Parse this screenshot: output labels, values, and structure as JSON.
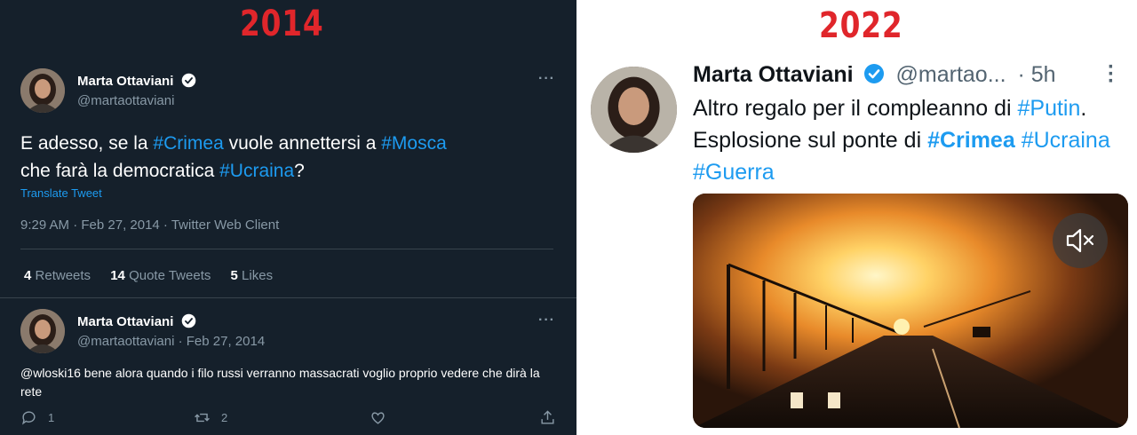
{
  "labels": {
    "left_year": "2014",
    "right_year": "2022"
  },
  "tweet_2014": {
    "name": "Marta Ottaviani",
    "handle": "@martaottaviani",
    "text_parts": [
      "E adesso, se la ",
      "#Crimea",
      " vuole annettersi a ",
      "#Mosca",
      " che farà la democratica ",
      "#Ucraina",
      "?"
    ],
    "translate_label": "Translate Tweet",
    "meta": "9:29 AM · Feb 27, 2014 · Twitter Web Client",
    "stats": [
      {
        "count": "4",
        "label": "Retweets"
      },
      {
        "count": "14",
        "label": "Quote Tweets"
      },
      {
        "count": "5",
        "label": "Likes"
      }
    ],
    "more_icon": "more-horizontal-icon"
  },
  "reply_2014": {
    "name": "Marta Ottaviani",
    "handle_date": "@martaottaviani · Feb 27, 2014",
    "text": "@wloski16 bene alora quando i filo russi verranno massacrati voglio proprio vedere che dirà la rete",
    "actions": {
      "reply_count": "1",
      "retweet_count": "2"
    }
  },
  "tweet_2022": {
    "name": "Marta Ottaviani",
    "handle": "@martao...",
    "time": "· 5h",
    "text_parts": [
      "Altro regalo per il compleanno di ",
      "#Putin",
      ". Esplosione sul ponte di ",
      "#Crimea",
      " ",
      "#Ucraina",
      " ",
      "#Guerra"
    ],
    "media": "video-explosion-bridge",
    "mute_icon": "mute-icon"
  },
  "colors": {
    "dark_bg": "#15202b",
    "link_blue": "#1d9bf0",
    "year_red": "#e0262b",
    "muted_gray": "#8899a6"
  }
}
